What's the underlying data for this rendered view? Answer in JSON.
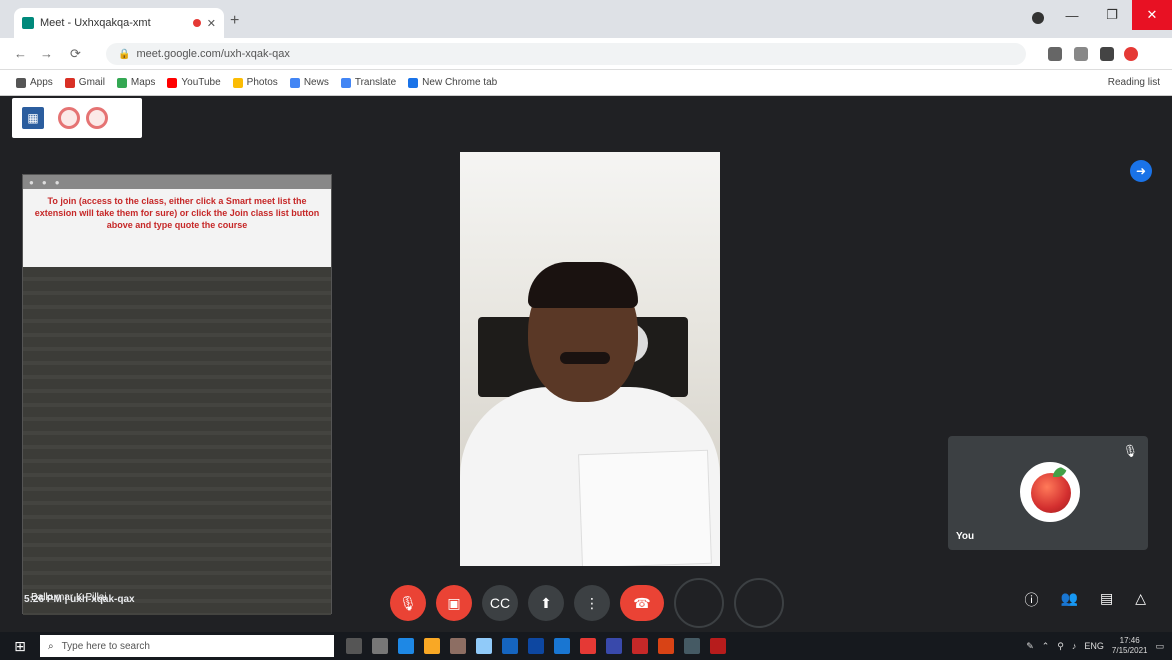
{
  "browser": {
    "tab_title": "Meet - Uxhxqakqa-xmt",
    "url": "meet.google.com/uxh-xqak-qax",
    "bookmarks": [
      "Apps",
      "Gmail",
      "Maps",
      "YouTube",
      "Photos",
      "News",
      "Translate",
      "New Chrome tab"
    ],
    "bookmarks_right": "Reading list"
  },
  "meet": {
    "presentation_notice": "To join (access to the class, either click a Smart meet list the extension will take them for sure) or click the Join class list button above and type quote the course",
    "presenter_name": "Balkumar K Pillai",
    "self_name": "You",
    "meeting_info": "5:26 PM | uxh-xqak-qax"
  },
  "taskbar": {
    "search_placeholder": "Type here to search",
    "time": "17:46",
    "date": "7/15/2021",
    "lang": "ENG"
  },
  "colors": {
    "meet_bg": "#202124",
    "end_call": "#ea4335",
    "accent": "#1a73e8"
  }
}
